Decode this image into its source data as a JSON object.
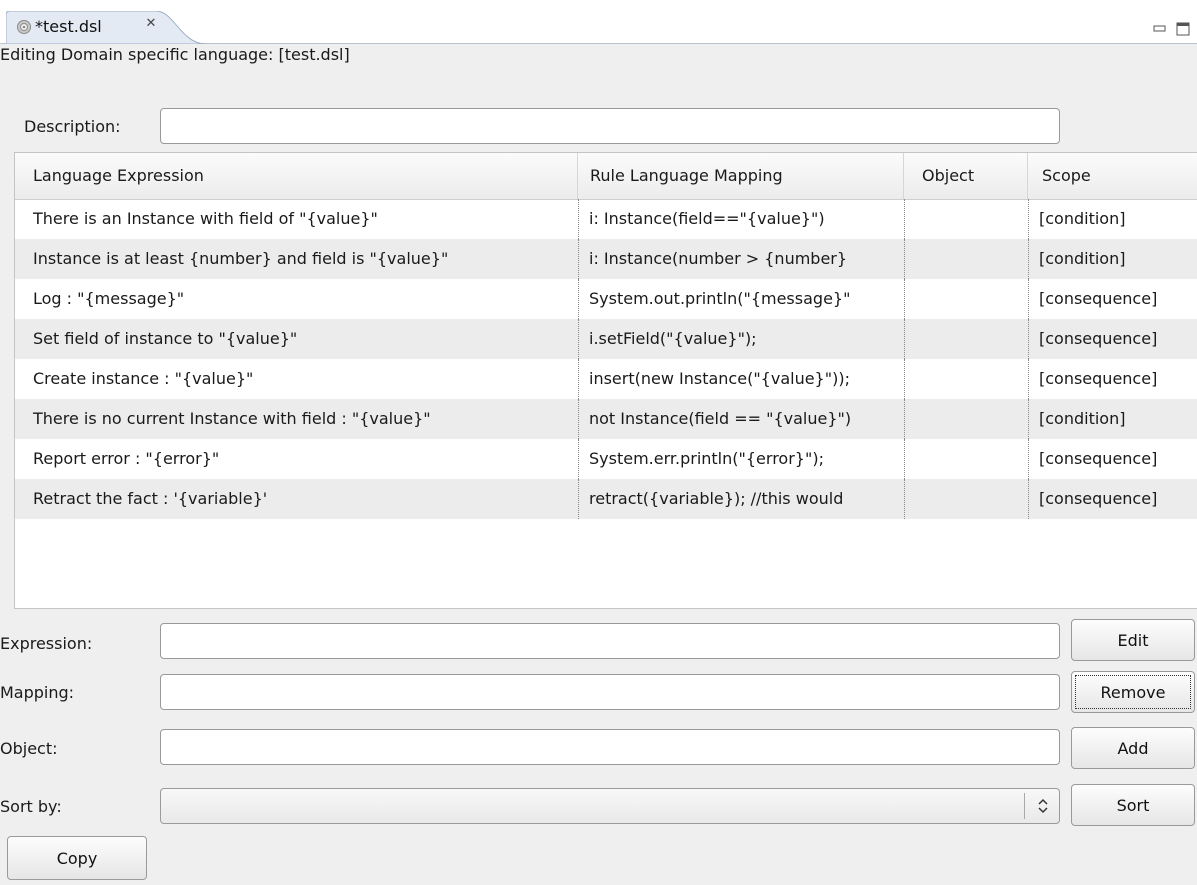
{
  "tab": {
    "title": "*test.dsl",
    "icon": "gear-icon",
    "close_icon": "close-icon"
  },
  "editor": {
    "title": "Editing Domain specific language: [test.dsl]"
  },
  "description": {
    "label": "Description:",
    "value": ""
  },
  "table": {
    "columns": [
      "Language Expression",
      "Rule Language Mapping",
      "Object",
      "Scope"
    ],
    "rows": [
      [
        "There is an Instance with field of \"{value}\"",
        "i: Instance(field==\"{value}\")",
        "",
        "[condition]"
      ],
      [
        "Instance is at least {number} and field is \"{value}\"",
        "i: Instance(number > {number}",
        "",
        "[condition]"
      ],
      [
        "Log : \"{message}\"",
        "System.out.println(\"{message}\"",
        "",
        "[consequence]"
      ],
      [
        "Set field of instance to \"{value}\"",
        "i.setField(\"{value}\");",
        "",
        "[consequence]"
      ],
      [
        "Create instance : \"{value}\"",
        "insert(new Instance(\"{value}\"));",
        "",
        "[consequence]"
      ],
      [
        "There is no current Instance with field : \"{value}\"",
        "not Instance(field == \"{value}\")",
        "",
        "[condition]"
      ],
      [
        "Report error : \"{error}\"",
        "System.err.println(\"{error}\");",
        "",
        "[consequence]"
      ],
      [
        "Retract the fact : '{variable}'",
        "retract({variable}); //this would",
        "",
        "[consequence]"
      ]
    ]
  },
  "form": {
    "expression_label": "Expression:",
    "expression_value": "",
    "mapping_label": "Mapping:",
    "mapping_value": "",
    "object_label": "Object:",
    "object_value": "",
    "sortby_label": "Sort by:",
    "sortby_value": ""
  },
  "buttons": {
    "edit": "Edit",
    "remove": "Remove",
    "add": "Add",
    "sort": "Sort",
    "copy": "Copy"
  }
}
